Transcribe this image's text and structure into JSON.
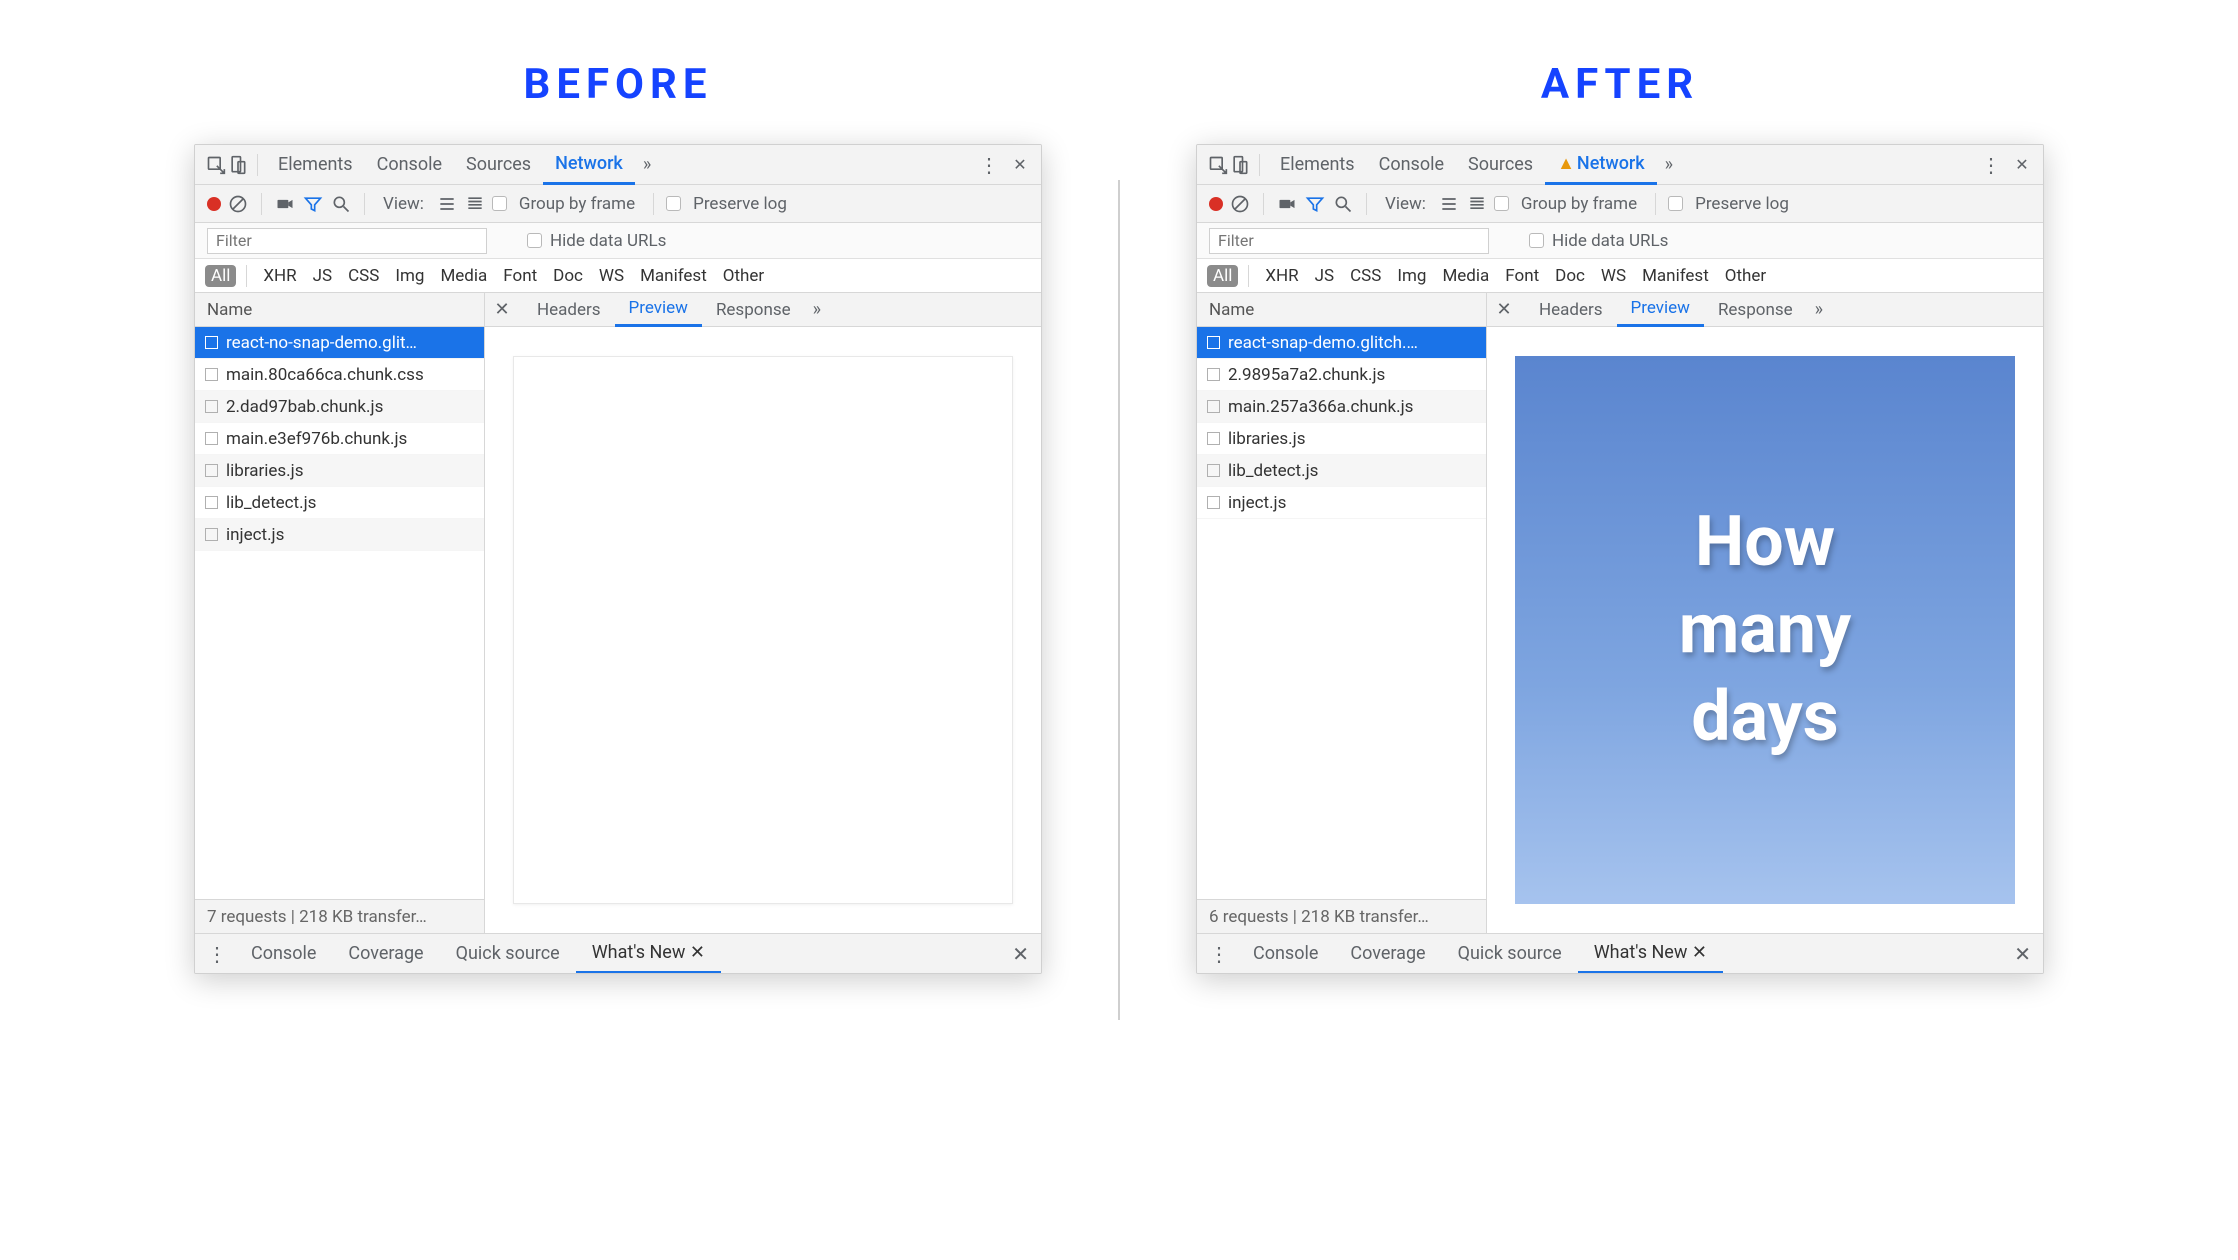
{
  "titles": {
    "before": "BEFORE",
    "after": "AFTER"
  },
  "devtools_tabs": {
    "elements": "Elements",
    "console": "Console",
    "sources": "Sources",
    "network": "Network",
    "more": "»"
  },
  "toolbar": {
    "view": "View:",
    "group_by_frame": "Group by frame",
    "preserve_log": "Preserve log"
  },
  "filter": {
    "placeholder": "Filter",
    "hide_data_urls": "Hide data URLs"
  },
  "categories": [
    "All",
    "XHR",
    "JS",
    "CSS",
    "Img",
    "Media",
    "Font",
    "Doc",
    "WS",
    "Manifest",
    "Other"
  ],
  "name_header": "Name",
  "resp_tabs": {
    "headers": "Headers",
    "preview": "Preview",
    "response": "Response",
    "more": "»"
  },
  "before": {
    "requests": [
      "react-no-snap-demo.glit…",
      "main.80ca66ca.chunk.css",
      "2.dad97bab.chunk.js",
      "main.e3ef976b.chunk.js",
      "libraries.js",
      "lib_detect.js",
      "inject.js"
    ],
    "status": "7 requests | 218 KB transfer…"
  },
  "after": {
    "requests": [
      "react-snap-demo.glitch.…",
      "2.9895a7a2.chunk.js",
      "main.257a366a.chunk.js",
      "libraries.js",
      "lib_detect.js",
      "inject.js"
    ],
    "status": "6 requests | 218 KB transfer…",
    "hero": {
      "l1": "How",
      "l2": "many",
      "l3": "days"
    }
  },
  "drawer_tabs": {
    "console": "Console",
    "coverage": "Coverage",
    "quicksource": "Quick source",
    "whatsnew": "What's New"
  }
}
